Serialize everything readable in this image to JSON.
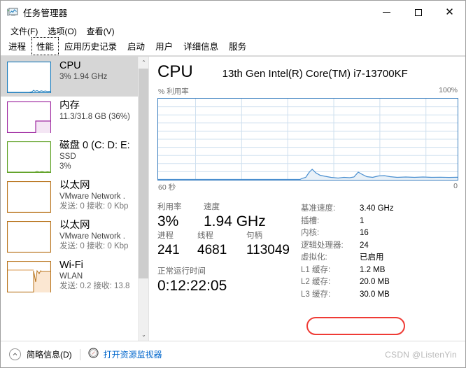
{
  "window": {
    "title": "任务管理器",
    "icon": "task-manager-icon",
    "minimize": "–",
    "maximize": "▢",
    "close": "✕"
  },
  "menubar": {
    "items": [
      {
        "label": "文件(F)",
        "name": "menu-file"
      },
      {
        "label": "选项(O)",
        "name": "menu-options"
      },
      {
        "label": "查看(V)",
        "name": "menu-view"
      }
    ]
  },
  "tabs": {
    "selected": "性能",
    "items": [
      {
        "label": "进程"
      },
      {
        "label": "性能"
      },
      {
        "label": "应用历史记录"
      },
      {
        "label": "启动"
      },
      {
        "label": "用户"
      },
      {
        "label": "详细信息"
      },
      {
        "label": "服务"
      }
    ]
  },
  "sidebar": {
    "items": [
      {
        "title": "CPU",
        "sub1": "3% 1.94 GHz",
        "sub2": "",
        "color": "#1b7bbb",
        "selected": true
      },
      {
        "title": "内存",
        "sub1": "11.3/31.8 GB (36%)",
        "sub2": "",
        "color": "#9e29a0",
        "selected": false
      },
      {
        "title": "磁盘 0 (C: D: E:",
        "sub1": "SSD",
        "sub2": "3%",
        "color": "#5a9e1e",
        "selected": false
      },
      {
        "title": "以太网",
        "sub1": "VMware Network .",
        "sub2": "发送: 0 接收: 0 Kbp",
        "color": "#b8731b",
        "selected": false
      },
      {
        "title": "以太网",
        "sub1": "VMware Network .",
        "sub2": "发送: 0 接收: 0 Kbp",
        "color": "#b8731b",
        "selected": false
      },
      {
        "title": "Wi-Fi",
        "sub1": "WLAN",
        "sub2": "发送: 0.2 接收: 13.8",
        "color": "#b8731b",
        "selected": false
      }
    ],
    "scroll_up": "⌃",
    "scroll_down": "⌄"
  },
  "main": {
    "title": "CPU",
    "subtitle": "13th Gen Intel(R) Core(TM) i7-13700KF",
    "graph": {
      "y_label": "% 利用率",
      "y_max": "100%",
      "x_left": "60 秒",
      "x_right": "0",
      "line_color": "#4a8fd0",
      "border_color": "#3a7ebf"
    },
    "stats": {
      "utilization_label": "利用率",
      "utilization_value": "3%",
      "speed_label": "速度",
      "speed_value": "1.94 GHz",
      "processes_label": "进程",
      "processes_value": "241",
      "threads_label": "线程",
      "threads_value": "4681",
      "handles_label": "句柄",
      "handles_value": "113049",
      "uptime_label": "正常运行时间",
      "uptime_value": "0:12:22:05"
    },
    "details": [
      {
        "key": "基准速度:",
        "value": "3.40 GHz"
      },
      {
        "key": "插槽:",
        "value": "1"
      },
      {
        "key": "内核:",
        "value": "16"
      },
      {
        "key": "逻辑处理器:",
        "value": "24"
      },
      {
        "key": "虚拟化:",
        "value": "已启用"
      },
      {
        "key": "L1 缓存:",
        "value": "1.2 MB"
      },
      {
        "key": "L2 缓存:",
        "value": "20.0 MB"
      },
      {
        "key": "L3 缓存:",
        "value": "30.0 MB"
      }
    ],
    "highlight_color": "#ef3b35"
  },
  "statusbar": {
    "fewer_details": "简略信息(D)",
    "fewer_icon": "chevron-up-circle-icon",
    "resource_monitor": "打开资源监视器",
    "resource_monitor_icon": "resource-monitor-icon",
    "watermark": "CSDN @ListenYin",
    "link_color": "#0066cc"
  },
  "chart_data": {
    "type": "area",
    "title": "% 利用率",
    "xlabel": "60 秒",
    "ylabel": "% 利用率",
    "ylim": [
      0,
      100
    ],
    "xlim": [
      60,
      0
    ],
    "grid": true,
    "grid_rows": 10,
    "grid_cols": 6,
    "series": [
      {
        "name": "CPU 利用率",
        "color": "#4a8fd0",
        "values": [
          0,
          0,
          0,
          0,
          0,
          0,
          0,
          0,
          0,
          0,
          0,
          0,
          0,
          0,
          0,
          0,
          0,
          0,
          0,
          0,
          0,
          0,
          0,
          0,
          0,
          0,
          0,
          0,
          0,
          0,
          0,
          0,
          0,
          0,
          0,
          0,
          0,
          0,
          0,
          0,
          9,
          6,
          4,
          3,
          3,
          3,
          3,
          4,
          3,
          7,
          3,
          3,
          4,
          4,
          3,
          3,
          3,
          3,
          3,
          3
        ]
      }
    ]
  }
}
